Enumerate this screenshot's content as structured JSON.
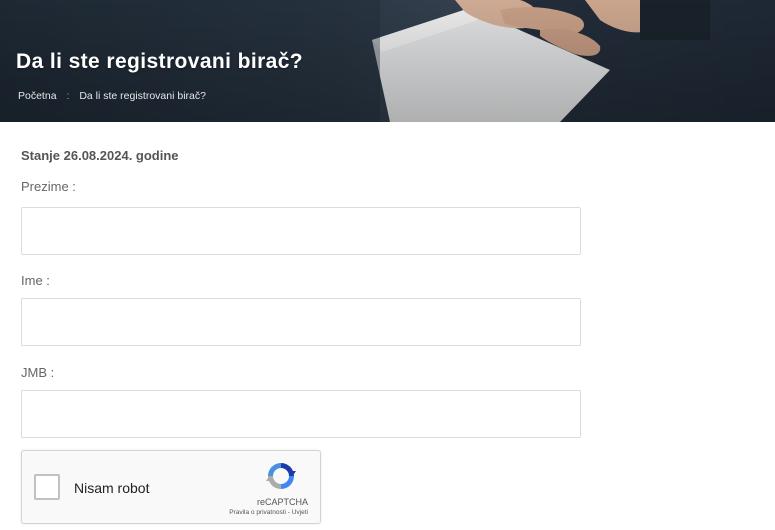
{
  "hero": {
    "title": "Da li ste registrovani birač?",
    "breadcrumb": {
      "home": "Početna",
      "separator": ":",
      "current": "Da li ste registrovani birač?"
    }
  },
  "form": {
    "status_date": "Stanje 26.08.2024. godine",
    "fields": [
      {
        "label": "Prezime :",
        "value": "",
        "placeholder": ""
      },
      {
        "label": "Ime :",
        "value": "",
        "placeholder": ""
      },
      {
        "label": "JMB :",
        "value": "",
        "placeholder": ""
      }
    ]
  },
  "recaptcha": {
    "checkbox_label": "Nisam robot",
    "brand": "reCAPTCHA",
    "privacy": "Pravila o privatnosti",
    "terms_separator": " - ",
    "terms": "Uvjeti",
    "logo_icon": "recaptcha-logo-icon"
  },
  "colors": {
    "hero_bg": "#2b3846",
    "input_border": "#d9dde1",
    "recaptcha_blue": "#4a90e2"
  }
}
